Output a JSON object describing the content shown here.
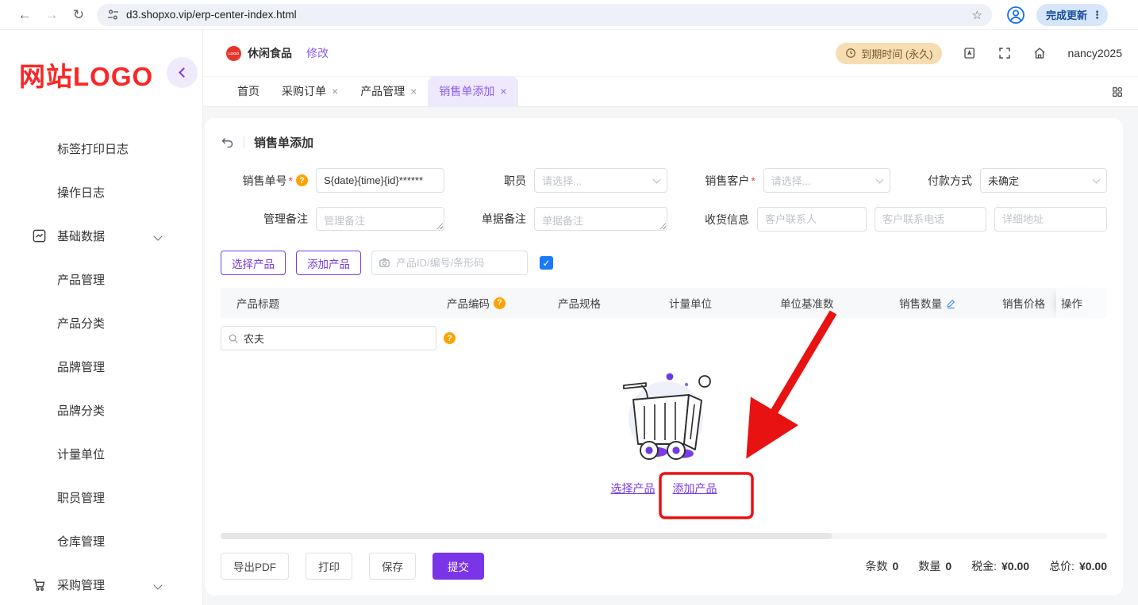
{
  "icons": {
    "close": "×",
    "star": "☆",
    "more_vert": "⋮",
    "back": "←",
    "forward": "→",
    "reload": "↻",
    "check": "✓",
    "question": "?"
  },
  "colors": {
    "accent": "#7a3be8",
    "accent_light": "#efe9fd",
    "logo_red": "#fb2626",
    "annotation_red": "#e81212",
    "expire_bg": "#f6ddb2",
    "checkbox_blue": "#1a7af8",
    "help_orange": "#ffa100"
  },
  "browser": {
    "url": "d3.shopxo.vip/erp-center-index.html",
    "update_button": "完成更新"
  },
  "sidebar": {
    "logo": "网站LOGO",
    "items": [
      {
        "label": "标签打印日志"
      },
      {
        "label": "操作日志"
      },
      {
        "label": "基础数据",
        "icon": "chart",
        "expandable": true
      },
      {
        "label": "产品管理"
      },
      {
        "label": "产品分类"
      },
      {
        "label": "品牌管理"
      },
      {
        "label": "品牌分类"
      },
      {
        "label": "计量单位"
      },
      {
        "label": "职员管理"
      },
      {
        "label": "仓库管理"
      },
      {
        "label": "采购管理",
        "icon": "cart",
        "expandable": true
      }
    ]
  },
  "topbar": {
    "store_badge": "LOGO",
    "store_name": "休闲食品",
    "edit_link": "修改",
    "expire_badge": "到期时间 (永久)",
    "username": "nancy2025"
  },
  "tabs": {
    "items": [
      {
        "label": "首页",
        "closable": false
      },
      {
        "label": "采购订单",
        "closable": true
      },
      {
        "label": "产品管理",
        "closable": true
      },
      {
        "label": "销售单添加",
        "closable": true,
        "active": true
      }
    ]
  },
  "page": {
    "title": "销售单添加"
  },
  "form": {
    "order_no": {
      "label": "销售单号",
      "value": "S{date}{time}{id}******"
    },
    "staff": {
      "label": "职员",
      "placeholder": "请选择..."
    },
    "customer": {
      "label": "销售客户",
      "placeholder": "请选择..."
    },
    "payment": {
      "label": "付款方式",
      "value": "未确定"
    },
    "admin_note": {
      "label": "管理备注",
      "placeholder": "管理备注"
    },
    "doc_note": {
      "label": "单据备注",
      "placeholder": "单据备注"
    },
    "shipping": {
      "label": "收货信息",
      "contact_placeholder": "客户联系人",
      "phone_placeholder": "客户联系电话",
      "address_placeholder": "详细地址"
    }
  },
  "product_bar": {
    "select_button": "选择产品",
    "add_button": "添加产品",
    "search_placeholder": "产品ID/编号/条形码"
  },
  "table": {
    "columns": {
      "title": "产品标题",
      "code": "产品编码",
      "spec": "产品规格",
      "unit": "计量单位",
      "base": "单位基准数",
      "qty": "销售数量",
      "price": "销售价格",
      "op": "操作"
    },
    "filter_value": "农夫"
  },
  "empty": {
    "select_link": "选择产品",
    "add_link": "添加产品"
  },
  "footer": {
    "export_pdf": "导出PDF",
    "print": "打印",
    "save": "保存",
    "submit": "提交",
    "totals": [
      {
        "label": "条数",
        "value": "0"
      },
      {
        "label": "数量",
        "value": "0"
      },
      {
        "label": "税金:",
        "value": "¥0.00"
      },
      {
        "label": "总价:",
        "value": "¥0.00"
      }
    ]
  }
}
